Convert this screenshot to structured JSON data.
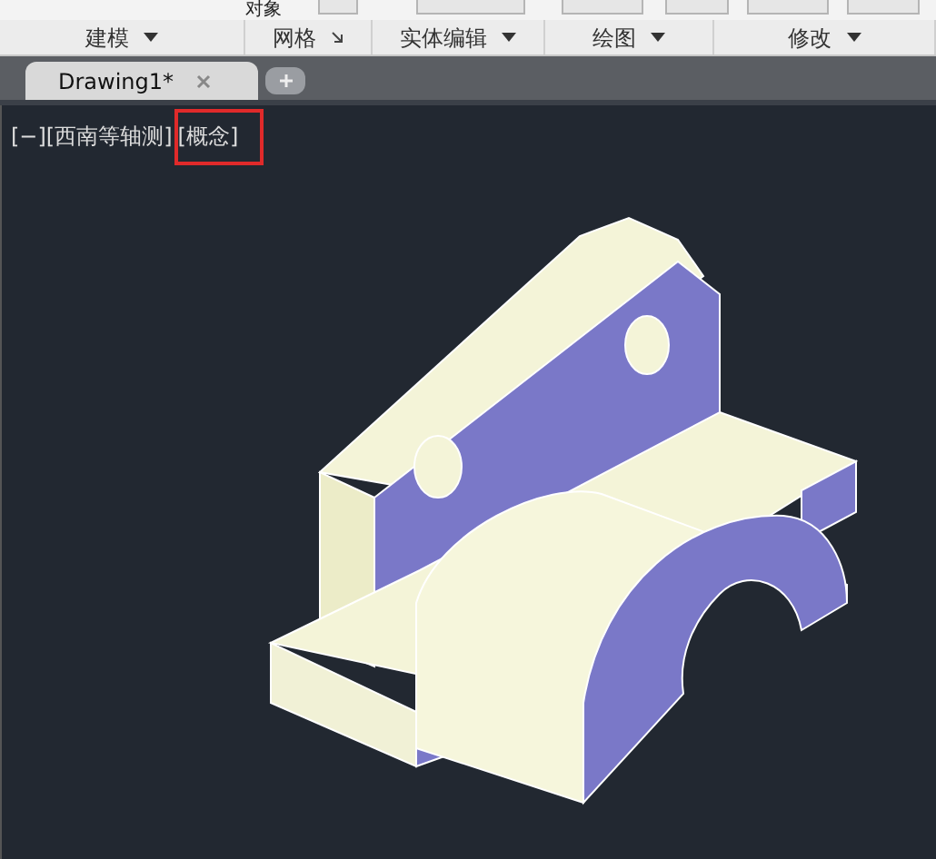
{
  "ribbon": {
    "top_label": "对象",
    "panels": [
      {
        "label": "建模",
        "kind": "dropdown"
      },
      {
        "label": "网格",
        "kind": "launcher"
      },
      {
        "label": "实体编辑",
        "kind": "dropdown"
      },
      {
        "label": "绘图",
        "kind": "dropdown"
      },
      {
        "label": "修改",
        "kind": "dropdown"
      }
    ]
  },
  "file_tabs": [
    {
      "label": "Drawing1*",
      "selected": true
    }
  ],
  "viewport": {
    "controls": [
      {
        "text": "[−]",
        "highlighted": false
      },
      {
        "text": "[西南等轴测]",
        "highlighted": false
      },
      {
        "text": "[概念]",
        "highlighted": true
      }
    ]
  }
}
